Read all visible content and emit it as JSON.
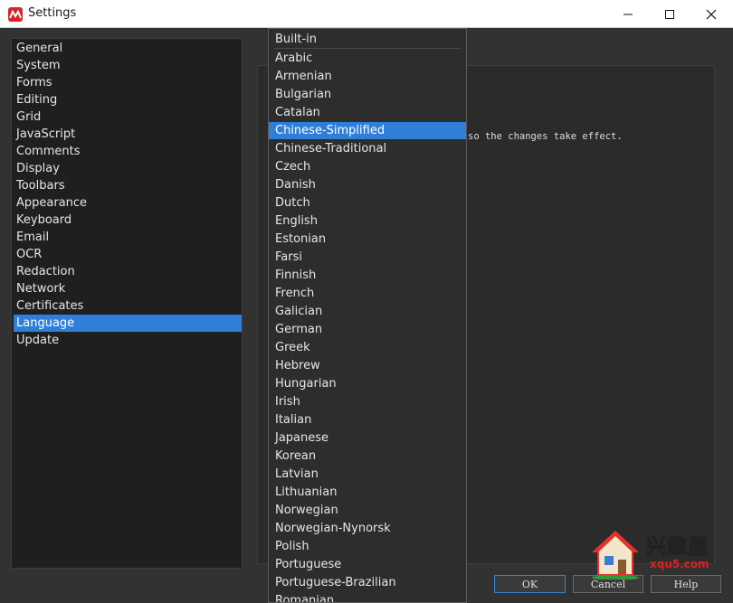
{
  "window": {
    "title": "Settings",
    "minimize_glyph": "—",
    "maximize_glyph": "☐",
    "close_glyph": "✕"
  },
  "categories": {
    "items": [
      "General",
      "System",
      "Forms",
      "Editing",
      "Grid",
      "JavaScript",
      "Comments",
      "Display",
      "Toolbars",
      "Appearance",
      "Keyboard",
      "Email",
      "OCR",
      "Redaction",
      "Network",
      "Certificates",
      "Language",
      "Update"
    ],
    "selected": "Language"
  },
  "language_panel": {
    "hint_fragment": "so the changes take effect."
  },
  "dropdown": {
    "header": "Built-in",
    "selected": "Chinese-Simplified",
    "items": [
      "Arabic",
      "Armenian",
      "Bulgarian",
      "Catalan",
      "Chinese-Simplified",
      "Chinese-Traditional",
      "Czech",
      "Danish",
      "Dutch",
      "English",
      "Estonian",
      "Farsi",
      "Finnish",
      "French",
      "Galician",
      "German",
      "Greek",
      "Hebrew",
      "Hungarian",
      "Irish",
      "Italian",
      "Japanese",
      "Korean",
      "Latvian",
      "Lithuanian",
      "Norwegian",
      "Norwegian-Nynorsk",
      "Polish",
      "Portuguese",
      "Portuguese-Brazilian",
      "Romanian"
    ]
  },
  "buttons": {
    "ok": "OK",
    "cancel": "Cancel",
    "help": "Help"
  },
  "watermark": {
    "main": "兴趣屋",
    "sub": "xqu5.com"
  },
  "colors": {
    "accent": "#2f7fd8",
    "brand_icon": "#d9252a"
  }
}
